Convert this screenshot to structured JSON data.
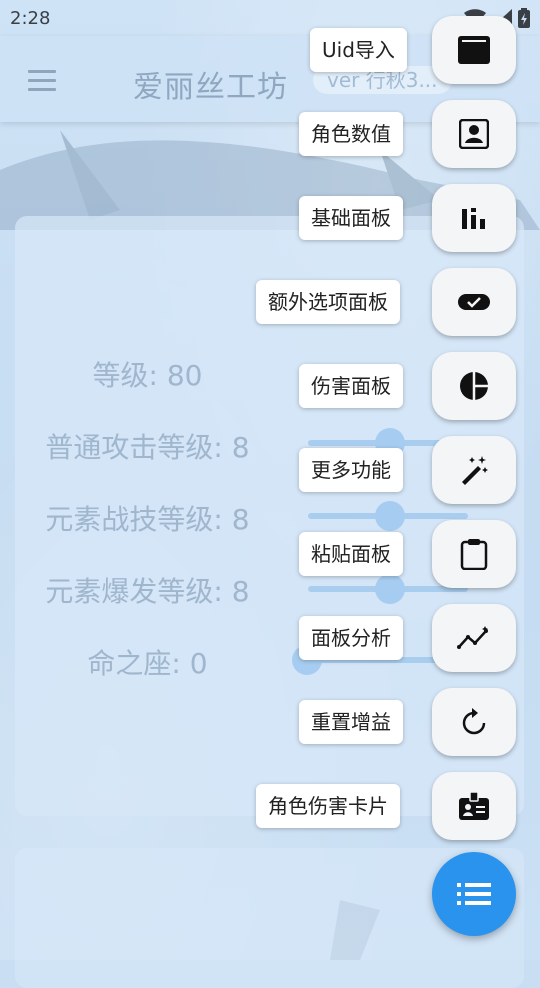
{
  "status_bar": {
    "time": "2:28"
  },
  "app_bar": {
    "title": "爱丽丝工坊",
    "version": "ver 行秋3..."
  },
  "stats": [
    {
      "text": "等级: 80"
    },
    {
      "text": "普通攻击等级: 8"
    },
    {
      "text": "元素战技等级: 8"
    },
    {
      "text": "元素爆发等级: 8"
    },
    {
      "text": "命之座: 0"
    }
  ],
  "actions": [
    {
      "label": "Uid导入",
      "icon": "web-asset-icon"
    },
    {
      "label": "角色数值",
      "icon": "account-box-icon"
    },
    {
      "label": "基础面板",
      "icon": "bar-chart-icon"
    },
    {
      "label": "额外选项面板",
      "icon": "toggle-check-icon"
    },
    {
      "label": "伤害面板",
      "icon": "pie-chart-icon"
    },
    {
      "label": "更多功能",
      "icon": "magic-wand-icon"
    },
    {
      "label": "粘贴面板",
      "icon": "clipboard-icon"
    },
    {
      "label": "面板分析",
      "icon": "analytics-icon"
    },
    {
      "label": "重置增益",
      "icon": "refresh-icon"
    },
    {
      "label": "角色伤害卡片",
      "icon": "badge-icon"
    }
  ],
  "fab": {
    "icon": "list-icon"
  },
  "colors": {
    "accent": "#2a93ee",
    "label_bg": "#ffffff",
    "button_bg": "#f4f5f7"
  }
}
